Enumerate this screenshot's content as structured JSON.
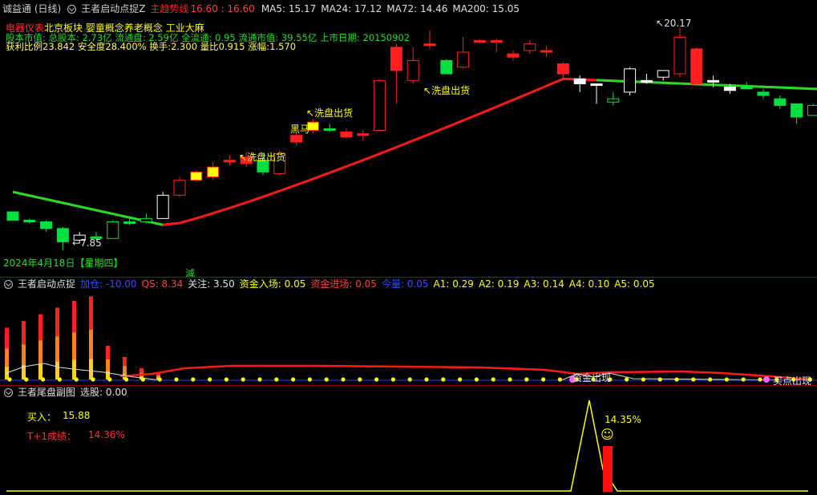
{
  "top_header": {
    "app": "诚益通 (日线)",
    "indicator": "王者启动点捉Z",
    "trend_label": "主趋势线",
    "trend_values": "16.60 : 16.60",
    "ma5": "MA5: 15.17",
    "ma24": "MA24: 17.12",
    "ma72": "MA72: 14.46",
    "ma200": "MA200: 15.05"
  },
  "info": {
    "line1_a": "电器仪表",
    "line1_b": "北京板块",
    "line1_c": "婴童概念",
    "line1_d": "养老概念",
    "line1_e": "工业大麻",
    "line2": "股本市值: 总股本: 2.73亿 流通盘: 2.59亿 全流通: 0.95 流通市值: 39.55亿 上市日期: 20150902",
    "line3": "获利比例23.842  安全度28.400%   换手:2.300  量比0.915  涨幅:1.570"
  },
  "annotations": {
    "xipan1": "洗盘出货",
    "xipan2": "洗盘出货",
    "xipan3": "洗盘出货",
    "heima": "黑马",
    "high": "20.17",
    "low": "7.85",
    "date": "2024年4月18日【星期四】",
    "jian": "減"
  },
  "panel2": {
    "title": "王者启动点捉",
    "jiacang": "加仓: -10.00",
    "qs": "QS: 8.34",
    "guanzhu": "关注: 3.50",
    "zjrc": "资金入场: 0.05",
    "zjjc": "资金进场: 0.05",
    "jinliang": "今量: 0.05",
    "a1": "A1: 0.29",
    "a2": "A2: 0.19",
    "a3": "A3: 0.14",
    "a4": "A4: 0.10",
    "a5": "A5: 0.05",
    "label_a": "资金出现",
    "label_b": "买点出现"
  },
  "panel3": {
    "title": "王者尾盘副图",
    "xuangu": "选股: 0.00",
    "buy_label": "买入：",
    "buy_value": "15.88",
    "t1_label": "T+1成绩：",
    "t1_value": "14.36%",
    "pct": "14.35%",
    "smile": "☺"
  },
  "colors": {
    "up": "#ff2020",
    "down": "#00e040",
    "white": "#ffffff",
    "yellow": "#ffff00",
    "ma_red": "#ff1a1a",
    "ma_green": "#22dd22"
  },
  "candles": [
    {
      "o": 9.1,
      "c": 8.6,
      "h": 9.1,
      "l": 8.6,
      "color": "down"
    },
    {
      "o": 8.6,
      "c": 8.5,
      "h": 8.7,
      "l": 8.4,
      "color": "down"
    },
    {
      "o": 8.5,
      "c": 8.1,
      "h": 8.6,
      "l": 7.9,
      "color": "down"
    },
    {
      "o": 8.1,
      "c": 7.3,
      "h": 8.2,
      "l": 6.8,
      "color": "down"
    },
    {
      "o": 7.4,
      "c": 7.7,
      "h": 7.9,
      "l": 7.2,
      "color": "hollow_white"
    },
    {
      "o": 7.6,
      "c": 7.5,
      "h": 7.9,
      "l": 7.4,
      "color": "down"
    },
    {
      "o": 7.5,
      "c": 8.5,
      "h": 8.6,
      "l": 7.5,
      "color": "hollow_green"
    },
    {
      "o": 8.5,
      "c": 8.5,
      "h": 8.7,
      "l": 8.3,
      "color": "down"
    },
    {
      "o": 8.5,
      "c": 8.7,
      "h": 9.0,
      "l": 8.4,
      "color": "hollow_green"
    },
    {
      "o": 8.7,
      "c": 10.1,
      "h": 10.3,
      "l": 8.7,
      "color": "hollow_white"
    },
    {
      "o": 10.1,
      "c": 11.0,
      "h": 11.2,
      "l": 10.0,
      "color": "hollow_red"
    },
    {
      "o": 11.0,
      "c": 11.5,
      "h": 11.6,
      "l": 10.9,
      "color": "yellow"
    },
    {
      "o": 11.2,
      "c": 11.8,
      "h": 12.1,
      "l": 11.0,
      "color": "yellow"
    },
    {
      "o": 12.2,
      "c": 12.1,
      "h": 12.5,
      "l": 11.9,
      "color": "red"
    },
    {
      "o": 12.0,
      "c": 12.4,
      "h": 12.7,
      "l": 11.8,
      "color": "red"
    },
    {
      "o": 12.2,
      "c": 11.5,
      "h": 12.6,
      "l": 11.3,
      "color": "down"
    },
    {
      "o": 11.4,
      "c": 12.6,
      "h": 12.8,
      "l": 11.3,
      "color": "hollow_red"
    },
    {
      "o": 13.3,
      "c": 13.7,
      "h": 13.9,
      "l": 13.1,
      "color": "red"
    },
    {
      "o": 14.0,
      "c": 14.5,
      "h": 14.7,
      "l": 13.8,
      "color": "yellow"
    },
    {
      "o": 14.1,
      "c": 14.1,
      "h": 14.4,
      "l": 13.9,
      "color": "down"
    },
    {
      "o": 13.9,
      "c": 13.6,
      "h": 14.1,
      "l": 13.5,
      "color": "red"
    },
    {
      "o": 13.8,
      "c": 13.7,
      "h": 14.0,
      "l": 13.4,
      "color": "red"
    },
    {
      "o": 14.0,
      "c": 17.0,
      "h": 17.1,
      "l": 14.0,
      "color": "hollow_red"
    },
    {
      "o": 19.0,
      "c": 17.6,
      "h": 19.2,
      "l": 15.6,
      "color": "red"
    },
    {
      "o": 17.0,
      "c": 18.2,
      "h": 19.0,
      "l": 16.8,
      "color": "hollow_red"
    },
    {
      "o": 19.2,
      "c": 19.1,
      "h": 20.0,
      "l": 18.9,
      "color": "red"
    },
    {
      "o": 18.2,
      "c": 17.4,
      "h": 18.3,
      "l": 17.4,
      "color": "down"
    },
    {
      "o": 17.8,
      "c": 18.7,
      "h": 19.6,
      "l": 17.7,
      "color": "hollow_red"
    },
    {
      "o": 19.4,
      "c": 19.4,
      "h": 19.5,
      "l": 19.2,
      "color": "red"
    },
    {
      "o": 19.4,
      "c": 19.3,
      "h": 19.5,
      "l": 18.7,
      "color": "red"
    },
    {
      "o": 18.6,
      "c": 18.4,
      "h": 18.8,
      "l": 18.2,
      "color": "red"
    },
    {
      "o": 18.8,
      "c": 19.2,
      "h": 19.4,
      "l": 18.6,
      "color": "hollow_red"
    },
    {
      "o": 18.8,
      "c": 18.7,
      "h": 19.1,
      "l": 18.4,
      "color": "red"
    },
    {
      "o": 17.4,
      "c": 18.0,
      "h": 18.1,
      "l": 17.1,
      "color": "red"
    },
    {
      "o": 17.1,
      "c": 16.8,
      "h": 17.3,
      "l": 16.3,
      "color": "white"
    },
    {
      "o": 16.8,
      "c": 16.7,
      "h": 16.8,
      "l": 15.6,
      "color": "white"
    },
    {
      "o": 15.7,
      "c": 15.9,
      "h": 16.3,
      "l": 15.5,
      "color": "hollow_green"
    },
    {
      "o": 16.3,
      "c": 17.7,
      "h": 17.8,
      "l": 16.1,
      "color": "hollow_white"
    },
    {
      "o": 17.0,
      "c": 17.0,
      "h": 17.4,
      "l": 16.8,
      "color": "white"
    },
    {
      "o": 17.6,
      "c": 17.2,
      "h": 17.6,
      "l": 17.0,
      "color": "hollow_white"
    },
    {
      "o": 17.4,
      "c": 19.6,
      "h": 20.17,
      "l": 17.2,
      "color": "hollow_red"
    },
    {
      "o": 18.9,
      "c": 16.8,
      "h": 19.0,
      "l": 16.8,
      "color": "red"
    },
    {
      "o": 17.0,
      "c": 16.9,
      "h": 17.3,
      "l": 16.6,
      "color": "white"
    },
    {
      "o": 16.6,
      "c": 16.4,
      "h": 16.8,
      "l": 16.2,
      "color": "white"
    },
    {
      "o": 16.6,
      "c": 16.6,
      "h": 16.9,
      "l": 16.5,
      "color": "down"
    },
    {
      "o": 16.3,
      "c": 16.1,
      "h": 16.5,
      "l": 15.9,
      "color": "down"
    },
    {
      "o": 15.9,
      "c": 15.5,
      "h": 16.1,
      "l": 15.3,
      "color": "down"
    },
    {
      "o": 15.6,
      "c": 14.8,
      "h": 15.6,
      "l": 14.4,
      "color": "down"
    },
    {
      "o": 14.9,
      "c": 15.5,
      "h": 15.6,
      "l": 14.9,
      "color": "hollow_green"
    },
    {
      "o": 15.4,
      "c": 15.4,
      "h": 15.8,
      "l": 15.1,
      "color": "down"
    }
  ],
  "panel2_bars": [
    2.3,
    2.6,
    2.9,
    3.2,
    3.5,
    3.7,
    1.5,
    1.0,
    0.5,
    0.3
  ]
}
